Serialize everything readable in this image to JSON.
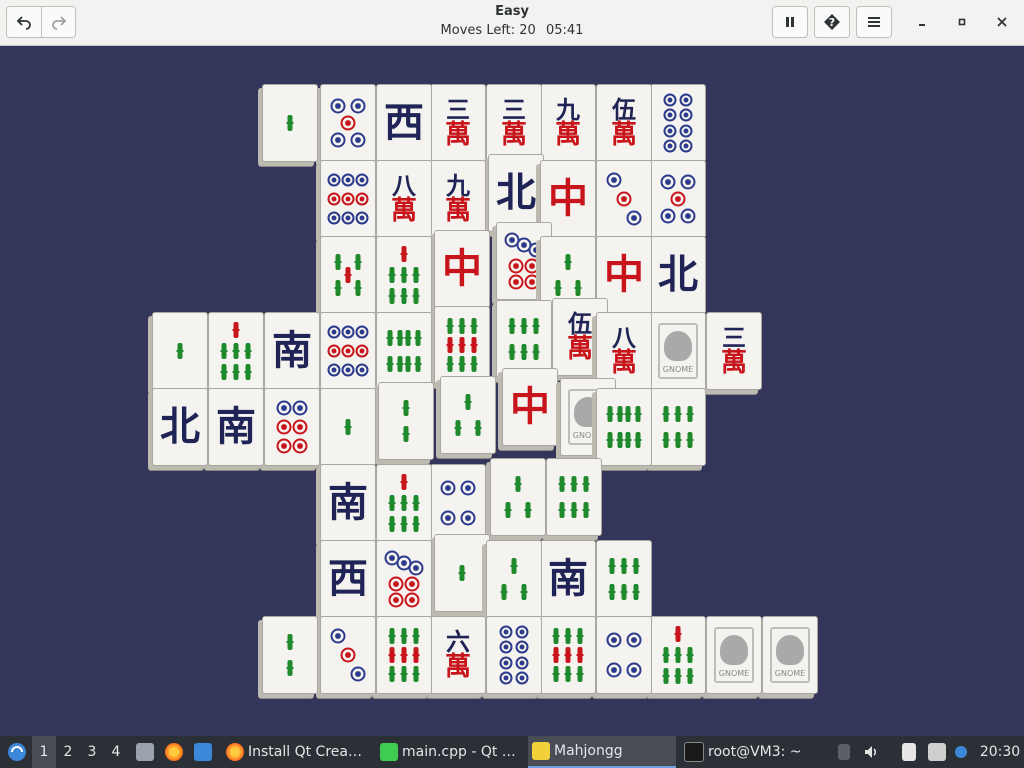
{
  "header": {
    "title": "Easy",
    "moves_label": "Moves Left: 20",
    "time": "05:41",
    "undo_icon": "undo-icon",
    "redo_icon": "redo-icon",
    "pause_icon": "pause-icon",
    "hint_icon": "hint-icon",
    "menu_icon": "menu-icon"
  },
  "tiles": [
    {
      "t": "b1"
    },
    {
      "t": "c5"
    },
    {
      "t": "west"
    },
    {
      "t": "m3"
    },
    {
      "t": "m3"
    },
    {
      "t": "m9"
    },
    {
      "t": "m5"
    },
    {
      "t": "c8"
    },
    {
      "t": "c9"
    },
    {
      "t": "m8"
    },
    {
      "t": "m9"
    },
    {
      "t": "north"
    },
    {
      "t": "red"
    },
    {
      "t": "c3"
    },
    {
      "t": "c5"
    },
    {
      "t": "b5"
    },
    {
      "t": "b7"
    },
    {
      "t": "red"
    },
    {
      "t": "c7"
    },
    {
      "t": "b3"
    },
    {
      "t": "red"
    },
    {
      "t": "north"
    },
    {
      "t": "b1"
    },
    {
      "t": "b7"
    },
    {
      "t": "south"
    },
    {
      "t": "c9"
    },
    {
      "t": "b8"
    },
    {
      "t": "b9"
    },
    {
      "t": "b6"
    },
    {
      "t": "m5"
    },
    {
      "t": "m8"
    },
    {
      "t": "gnome"
    },
    {
      "t": "m3"
    },
    {
      "t": "north"
    },
    {
      "t": "south"
    },
    {
      "t": "c6"
    },
    {
      "t": "b1"
    },
    {
      "t": "b2"
    },
    {
      "t": "b3"
    },
    {
      "t": "red"
    },
    {
      "t": "gnome"
    },
    {
      "t": "b8"
    },
    {
      "t": "b6"
    },
    {
      "t": "south"
    },
    {
      "t": "b7"
    },
    {
      "t": "c4"
    },
    {
      "t": "b3"
    },
    {
      "t": "b6"
    },
    {
      "t": "west"
    },
    {
      "t": "c7"
    },
    {
      "t": "b1"
    },
    {
      "t": "b3"
    },
    {
      "t": "south"
    },
    {
      "t": "b6"
    },
    {
      "t": "b2"
    },
    {
      "t": "c3"
    },
    {
      "t": "b9"
    },
    {
      "t": "m6"
    },
    {
      "t": "c8"
    },
    {
      "t": "b9"
    },
    {
      "t": "c4"
    },
    {
      "t": "b7"
    },
    {
      "t": "gnome"
    },
    {
      "t": "gnome"
    }
  ],
  "gnome_label": "GNOME",
  "glyphs": {
    "west": "西",
    "north": "北",
    "south": "南",
    "red": "中",
    "wan": "萬",
    "n3": "三",
    "n5": "伍",
    "n6": "六",
    "n8": "八",
    "n9": "九"
  },
  "colors": {
    "background": "#33355a",
    "tile_face": "#f4f3ef",
    "dot_blue": "#2c3a8c",
    "dot_red": "#c8141b",
    "bamboo_green": "#1f8a2c",
    "accent": "#6fa0e0"
  },
  "taskbar": {
    "start_icon": "lxqt-logo-icon",
    "workspaces": [
      "1",
      "2",
      "3",
      "4"
    ],
    "active_workspace": "1",
    "launchers": [
      "file-manager-icon",
      "firefox-icon",
      "desktop-icon"
    ],
    "tasks": [
      {
        "label": "Install Qt Crea…",
        "icon": "firefox-icon"
      },
      {
        "label": "main.cpp - Qt …",
        "icon": "qt-creator-icon"
      },
      {
        "label": "Mahjongg",
        "icon": "mahjongg-icon"
      },
      {
        "label": "root@VM3: ~",
        "icon": "terminal-icon"
      }
    ],
    "clock": "20:30",
    "tray_icons": [
      "volume-icon",
      "clipboard-icon",
      "network-icon"
    ]
  }
}
